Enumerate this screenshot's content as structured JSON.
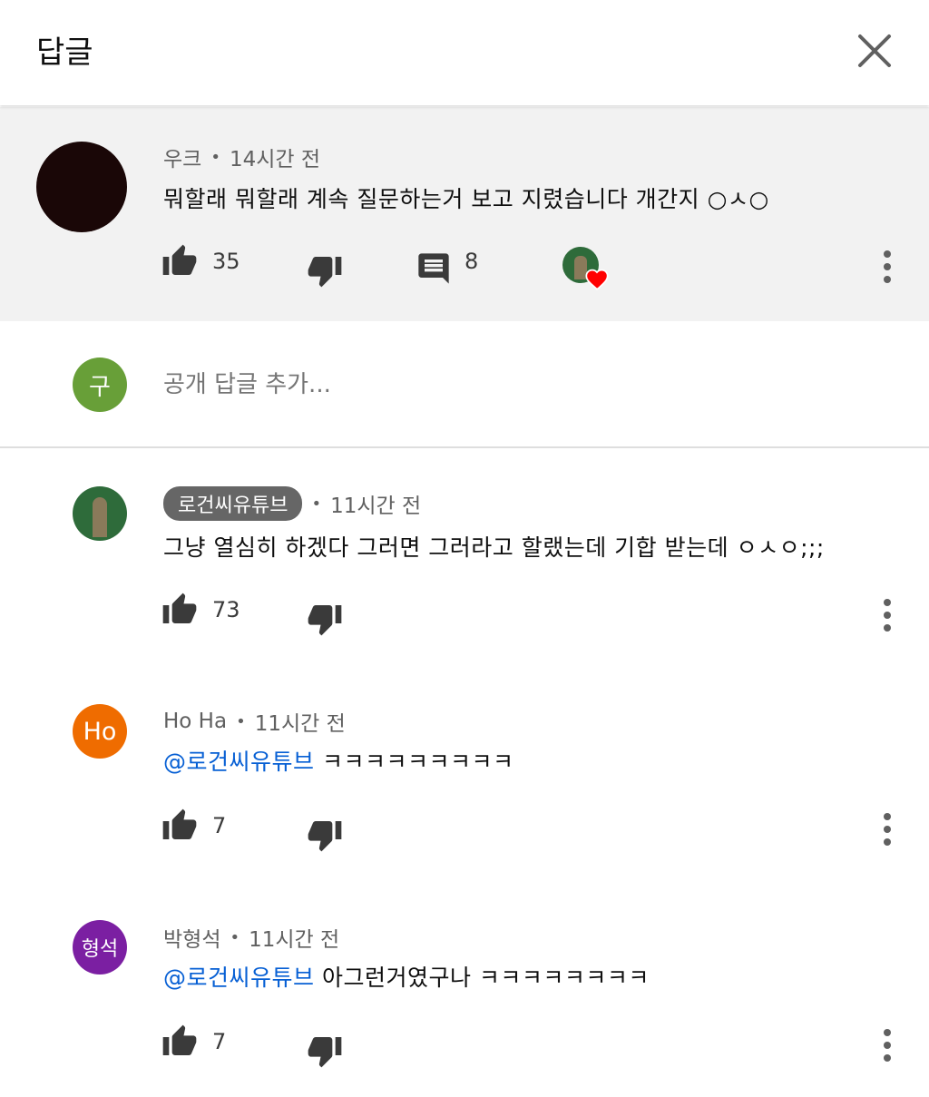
{
  "header": {
    "title": "답글"
  },
  "parent": {
    "author": "우크",
    "time": "14시간 전",
    "text": "뭐할래 뭐할래 계속 질문하는거 보고 지렸습니다 개간지 ○ㅅ○",
    "likes": "35",
    "replies": "8"
  },
  "composer": {
    "avatar_letter": "구",
    "placeholder": "공개 답글 추가..."
  },
  "replies": [
    {
      "author": "로건씨유튜브",
      "time": "11시간 전",
      "mention": "",
      "text": "그냥 열심히 하겠다 그러면 그러라고 할랬는데 기합 받는데 ㅇㅅㅇ;;;",
      "likes": "73"
    },
    {
      "author": "Ho Ha",
      "avatar_letter": "Ho",
      "time": "11시간 전",
      "mention": "@로건씨유튜브",
      "text": " ㅋㅋㅋㅋㅋㅋㅋㅋㅋ",
      "likes": "7"
    },
    {
      "author": "박형석",
      "avatar_letter": "형석",
      "time": "11시간 전",
      "mention": "@로건씨유튜브",
      "text": " 아그런거였구나 ㅋㅋㅋㅋㅋㅋㅋㅋ",
      "likes": "7"
    }
  ],
  "colors": {
    "ho_avatar": "#ef6c00",
    "hyung_avatar": "#7b1fa2",
    "composer_avatar": "#689f38",
    "mention": "#065fd4",
    "heart": "#ff0000"
  }
}
